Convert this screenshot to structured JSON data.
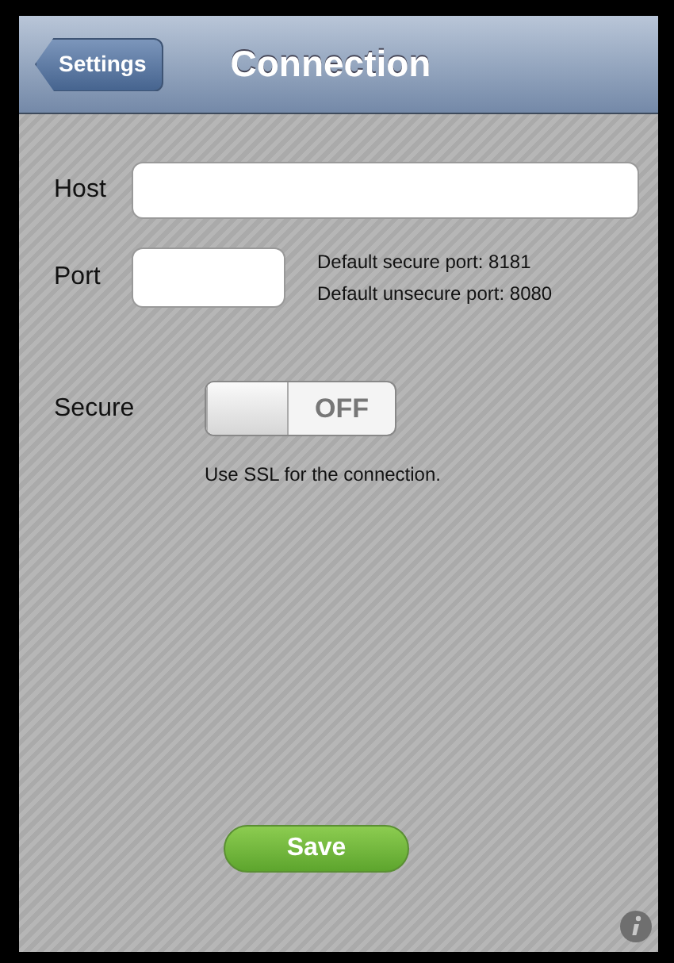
{
  "nav": {
    "back": "Settings",
    "title": "Connection"
  },
  "host": {
    "label": "Host"
  },
  "port": {
    "label": "Port",
    "hints": [
      "Default secure port: 8181",
      "Default unsecure port: 8080"
    ]
  },
  "secure": {
    "label": "Secure",
    "on": false,
    "switch_text": "OFF",
    "caption": "Use SSL for the connection."
  },
  "save": "Save"
}
